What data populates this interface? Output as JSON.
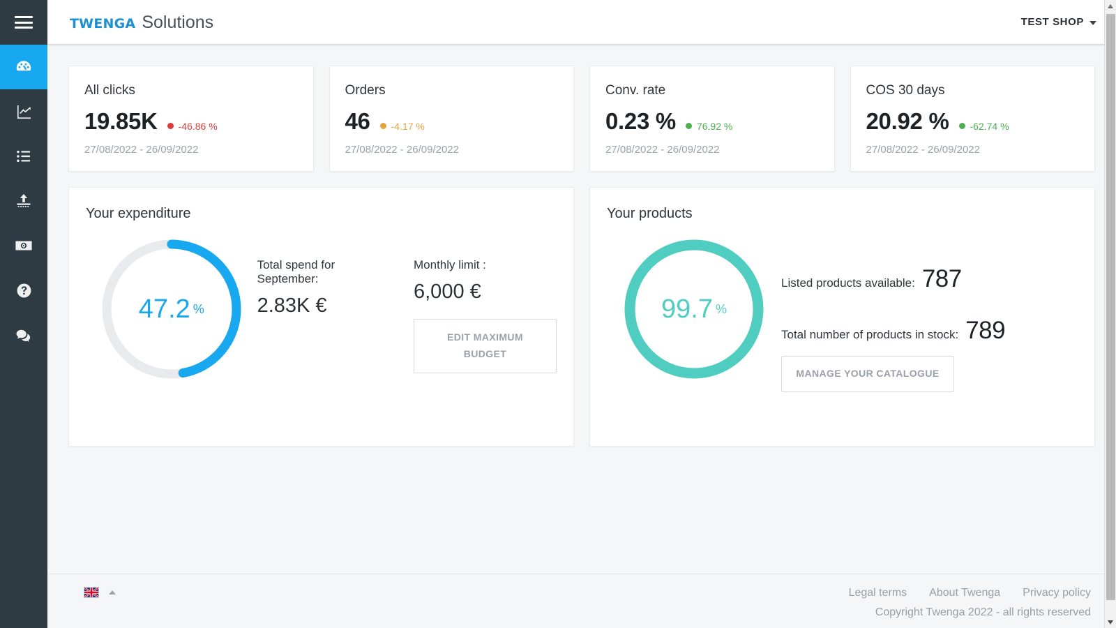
{
  "colors": {
    "accent_blue": "#17a8ef",
    "teal": "#4ecdc0",
    "sidebar_bg": "#2e3b43",
    "red": "#dc3c3c",
    "orange": "#e8a33d",
    "green": "#4caf50",
    "muted": "#9aa1a8"
  },
  "sidebar": {
    "menu_toggle": "menu-hamburger",
    "items": [
      {
        "icon": "dashboard-gauge-icon",
        "name": "dashboard",
        "active": true
      },
      {
        "icon": "chart-line-icon",
        "name": "statistics",
        "active": false
      },
      {
        "icon": "list-icon",
        "name": "catalogue-list",
        "active": false
      },
      {
        "icon": "upload-icon",
        "name": "upload-feed",
        "active": false
      },
      {
        "icon": "banknote-icon",
        "name": "billing",
        "active": false
      },
      {
        "icon": "help-circle-icon",
        "name": "help",
        "active": false
      },
      {
        "icon": "chat-bubbles-icon",
        "name": "support-chat",
        "active": false
      }
    ]
  },
  "header": {
    "brand_main": "Twenga",
    "brand_sub": "Solutions",
    "shop_label": "TEST SHOP",
    "shop_caret": "chevron-down-icon"
  },
  "kpis": [
    {
      "title": "All clicks",
      "value": "19.85K",
      "delta": "-46.86 %",
      "delta_color": "#dc3c3c",
      "range": "27/08/2022 - 26/09/2022"
    },
    {
      "title": "Orders",
      "value": "46",
      "delta": "-4.17 %",
      "delta_color": "#e8a33d",
      "range": "27/08/2022 - 26/09/2022"
    },
    {
      "title": "Conv. rate",
      "value": "0.23 %",
      "delta": "76.92 %",
      "delta_color": "#4caf50",
      "range": "27/08/2022 - 26/09/2022"
    },
    {
      "title": "COS 30 days",
      "value": "20.92 %",
      "delta": "-62.74 %",
      "delta_color": "#4caf50",
      "range": "27/08/2022 - 26/09/2022"
    }
  ],
  "expenditure": {
    "title": "Your expenditure",
    "gauge": {
      "value": 47.2,
      "display": "47.2",
      "unit": "%",
      "color": "#17a8ef",
      "track_color": "#e8eaed"
    },
    "spend_label": "Total spend for September:",
    "spend_value": "2.83K €",
    "limit_label": "Monthly limit :",
    "limit_value": "6,000 €",
    "button_label": "EDIT MAXIMUM BUDGET"
  },
  "products": {
    "title": "Your products",
    "gauge": {
      "value": 99.7,
      "display": "99.7",
      "unit": "%",
      "color": "#4ecdc0",
      "track_color": "#e8eaed"
    },
    "listed_label": "Listed products available:",
    "listed_value": "787",
    "stock_label": "Total number of products in stock:",
    "stock_value": "789",
    "button_label": "MANAGE YOUR CATALOGUE"
  },
  "footer": {
    "language_flag": "uk-flag-icon",
    "language_chevron": "chevron-up-icon",
    "links": [
      "Legal terms",
      "About Twenga",
      "Privacy policy"
    ],
    "copyright": "Copyright Twenga 2022 - all rights reserved"
  },
  "scrollbar": {
    "up_arrow": "scroll-up-arrow-icon",
    "down_arrow": "scroll-down-arrow-icon"
  }
}
